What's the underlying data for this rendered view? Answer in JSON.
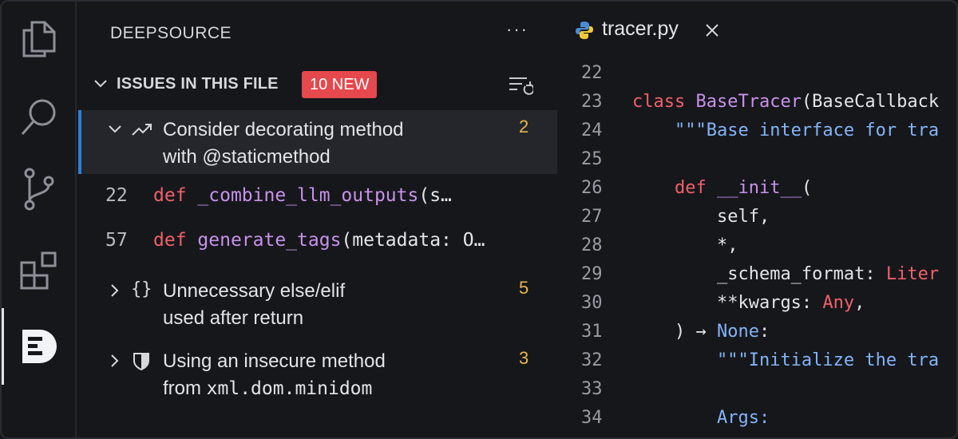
{
  "sidebar": {
    "title": "DEEPSOURCE",
    "more": "···",
    "section": {
      "label": "ISSUES IN THIS FILE",
      "badge": "10 NEW"
    },
    "issues": [
      {
        "icon": "trending-up-icon",
        "title_text": "Consider decorating method",
        "title_mono": "with @staticmethod",
        "count": "2"
      },
      {
        "icon": "braces-icon",
        "icon_glyph": "{}",
        "title_text": "Unnecessary else/elif",
        "title_mono": "used after return",
        "count": "5"
      },
      {
        "icon": "shield-icon",
        "title_text": "Using an insecure method",
        "title_prefix": "from ",
        "title_mono": "xml.dom.minidom",
        "count": "3"
      }
    ],
    "occurrences": [
      {
        "line": "22",
        "kw": "def",
        "fn": "_combine_llm_outputs",
        "rest": "(s…"
      },
      {
        "line": "57",
        "kw": "def",
        "fn": "generate_tags",
        "rest": "(metadata: O…"
      }
    ]
  },
  "editor": {
    "tab": {
      "label": "tracer.py"
    },
    "lines": [
      {
        "n": "22"
      },
      {
        "n": "23"
      },
      {
        "n": "24"
      },
      {
        "n": "25"
      },
      {
        "n": "26"
      },
      {
        "n": "27"
      },
      {
        "n": "28"
      },
      {
        "n": "29"
      },
      {
        "n": "30"
      },
      {
        "n": "31"
      },
      {
        "n": "32"
      },
      {
        "n": "33"
      },
      {
        "n": "34"
      }
    ],
    "code": {
      "l23_kw": "class",
      "l23_cls": "BaseTracer",
      "l23_rest": "(BaseCallback",
      "l24_str": "\"\"\"Base interface for tra",
      "l26_kw": "def",
      "l26_fn": "__init__",
      "l26_rest": "(",
      "l27": "self,",
      "l28": "*,",
      "l29_a": "_schema_format: ",
      "l29_type": "Liter",
      "l30_a": "**kwargs: ",
      "l30_type": "Any",
      "l30_b": ",",
      "l31_a": ") → ",
      "l31_none": "None",
      "l31_b": ":",
      "l32_str": "\"\"\"Initialize the tra",
      "l34_str": "Args:"
    }
  }
}
